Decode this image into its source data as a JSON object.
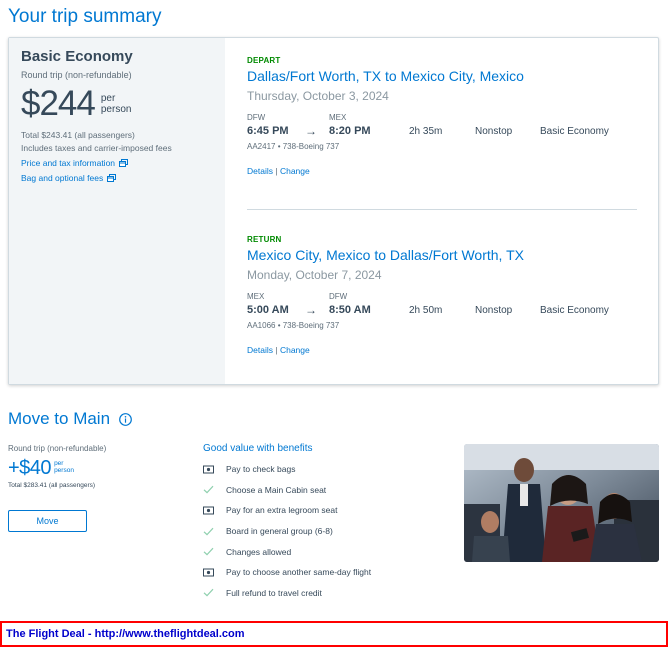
{
  "page": {
    "title": "Your trip summary"
  },
  "fare": {
    "name": "Basic Economy",
    "trip_type": "Round trip (non-refundable)",
    "price": "$244",
    "per_line1": "per",
    "per_line2": "person",
    "total": "Total $243.41 (all passengers)",
    "fees_note": "Includes taxes and carrier-imposed fees",
    "price_tax_link": "Price and tax information",
    "bag_fees_link": "Bag and optional fees"
  },
  "segments": [
    {
      "label": "DEPART",
      "route": "Dallas/Fort Worth, TX to Mexico City, Mexico",
      "date": "Thursday, October 3, 2024",
      "from_code": "DFW",
      "to_code": "MEX",
      "depart_time": "6:45 PM",
      "arrow": "→",
      "arrive_time": "8:20 PM",
      "duration": "2h 35m",
      "stops": "Nonstop",
      "cabin": "Basic Economy",
      "flight_info": "AA2417 • 738-Boeing 737",
      "details_link": "Details",
      "separator": "|",
      "change_link": "Change"
    },
    {
      "label": "RETURN",
      "route": "Mexico City, Mexico to Dallas/Fort Worth, TX",
      "date": "Monday, October 7, 2024",
      "from_code": "MEX",
      "to_code": "DFW",
      "depart_time": "5:00 AM",
      "arrow": "→",
      "arrive_time": "8:50 AM",
      "duration": "2h 50m",
      "stops": "Nonstop",
      "cabin": "Basic Economy",
      "flight_info": "AA1066 • 738-Boeing 737",
      "details_link": "Details",
      "separator": "|",
      "change_link": "Change"
    }
  ],
  "upsell": {
    "title": "Move to Main",
    "trip_type": "Round trip (non-refundable)",
    "price": "+$40",
    "per_line1": "per",
    "per_line2": "person",
    "total": "Total $283.41 (all passengers)",
    "button_label": "Move",
    "benefits_title": "Good value with benefits",
    "benefits": [
      {
        "icon": "dollar-bill-icon",
        "text": "Pay to check bags"
      },
      {
        "icon": "checkmark-icon",
        "text": "Choose a Main Cabin seat"
      },
      {
        "icon": "dollar-bill-icon",
        "text": "Pay for an extra legroom seat"
      },
      {
        "icon": "checkmark-icon",
        "text": "Board in general group (6-8)"
      },
      {
        "icon": "checkmark-icon",
        "text": "Changes allowed"
      },
      {
        "icon": "dollar-bill-icon",
        "text": "Pay to choose another same-day flight"
      },
      {
        "icon": "checkmark-icon",
        "text": "Full refund to travel credit"
      }
    ]
  },
  "footer": {
    "text": "The Flight Deal - http://www.theflightdeal.com"
  },
  "colors": {
    "brand_blue": "#0078d2",
    "depart_green": "#008a00",
    "check_green": "#8fd0ae",
    "footer_border": "#ff0000",
    "footer_text": "#0000cc"
  }
}
